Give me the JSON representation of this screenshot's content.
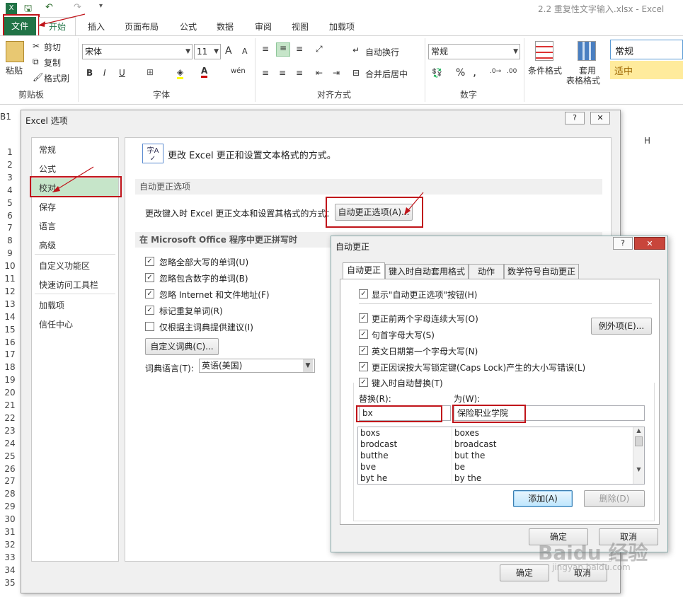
{
  "window": {
    "title": "2.2 重复性文字输入.xlsx - Excel"
  },
  "ribbon": {
    "tabs": [
      "文件",
      "开始",
      "插入",
      "页面布局",
      "公式",
      "数据",
      "审阅",
      "视图",
      "加载项"
    ],
    "clipboard": {
      "paste": "粘贴",
      "cut": "剪切",
      "copy": "复制",
      "format_painter": "格式刷",
      "label": "剪贴板"
    },
    "font": {
      "name": "宋体",
      "size": "11",
      "bold": "B",
      "italic": "I",
      "underline": "U",
      "grow": "A",
      "shrink": "A",
      "label": "字体"
    },
    "alignment": {
      "wrap": "自动换行",
      "merge": "合并后居中",
      "label": "对齐方式"
    },
    "number": {
      "format": "常规",
      "percent": "%",
      "comma": ",",
      "label": "数字"
    },
    "styles": {
      "cond_format": "条件格式",
      "table_format": "套用",
      "table_format2": "表格格式",
      "normal": "常规",
      "neutral": "适中"
    },
    "col_h": "H"
  },
  "sheet": {
    "namebox": "B1",
    "rows": [
      "1",
      "2",
      "3",
      "4",
      "5",
      "6",
      "7",
      "8",
      "9",
      "10",
      "11",
      "12",
      "13",
      "14",
      "15",
      "16",
      "17",
      "18",
      "19",
      "20",
      "21",
      "22",
      "23",
      "24",
      "25",
      "26",
      "27",
      "28",
      "29",
      "30",
      "31",
      "32",
      "33",
      "34",
      "35"
    ]
  },
  "options_dialog": {
    "title": "Excel 选项",
    "help": "?",
    "close": "✕",
    "nav": [
      "常规",
      "公式",
      "校对",
      "保存",
      "语言",
      "高级",
      "自定义功能区",
      "快速访问工具栏",
      "加载项",
      "信任中心"
    ],
    "nav_selected": "校对",
    "header": "更改 Excel 更正和设置文本格式的方式。",
    "autocorrect_section": "自动更正选项",
    "autocorrect_desc": "更改键入时 Excel 更正文本和设置其格式的方式：",
    "autocorrect_button": "自动更正选项(A)...",
    "spelling_section": "在 Microsoft Office 程序中更正拼写时",
    "checks": [
      {
        "label": "忽略全部大写的单词(U)",
        "checked": true
      },
      {
        "label": "忽略包含数字的单词(B)",
        "checked": true
      },
      {
        "label": "忽略 Internet 和文件地址(F)",
        "checked": true
      },
      {
        "label": "标记重复单词(R)",
        "checked": true
      },
      {
        "label": "仅根据主词典提供建议(I)",
        "checked": false
      }
    ],
    "custom_dict": "自定义词典(C)...",
    "dict_lang_label": "词典语言(T):",
    "dict_lang": "英语(美国)",
    "ok": "确定",
    "cancel": "取消"
  },
  "autocorrect_dialog": {
    "title": "自动更正",
    "help": "?",
    "close": "✕",
    "tabs": [
      "自动更正",
      "键入时自动套用格式",
      "动作",
      "数学符号自动更正"
    ],
    "show_buttons": "显示\"自动更正选项\"按钮(H)",
    "options": [
      "更正前两个字母连续大写(O)",
      "句首字母大写(S)",
      "英文日期第一个字母大写(N)",
      "更正因误按大写锁定键(Caps Lock)产生的大小写错误(L)"
    ],
    "exceptions": "例外项(E)...",
    "replace_while_typing": "键入时自动替换(T)",
    "replace_label": "替换(R):",
    "with_label": "为(W):",
    "replace_value": "bx",
    "with_value": "保险职业学院",
    "list": [
      [
        "boxs",
        "boxes"
      ],
      [
        "brodcast",
        "broadcast"
      ],
      [
        "butthe",
        "but the"
      ],
      [
        "bve",
        "be"
      ],
      [
        "byt he",
        "by the"
      ]
    ],
    "add": "添加(A)",
    "delete": "删除(D)",
    "ok": "确定",
    "cancel": "取消"
  },
  "watermark": {
    "main": "Baidu 经验",
    "sub": "jingyan.baidu.com"
  }
}
